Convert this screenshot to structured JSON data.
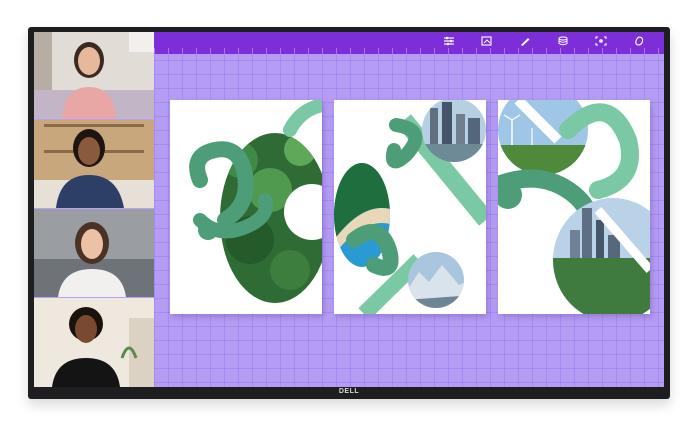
{
  "device": {
    "brand_logo": "DELL"
  },
  "participants": [
    {
      "name_icon": "participant-video"
    },
    {
      "name_icon": "participant-video"
    },
    {
      "name_icon": "participant-video"
    },
    {
      "name_icon": "participant-video"
    }
  ],
  "toolbar": {
    "tools": [
      "adjust-icon",
      "image-edit-icon",
      "pen-icon",
      "layers-icon",
      "focus-icon",
      "eraser-icon"
    ]
  },
  "colors": {
    "accent": "#7c2fd9",
    "canvas": "#b59df5",
    "leaf": "#4e9d79",
    "leaf_light": "#7bc9a4"
  }
}
